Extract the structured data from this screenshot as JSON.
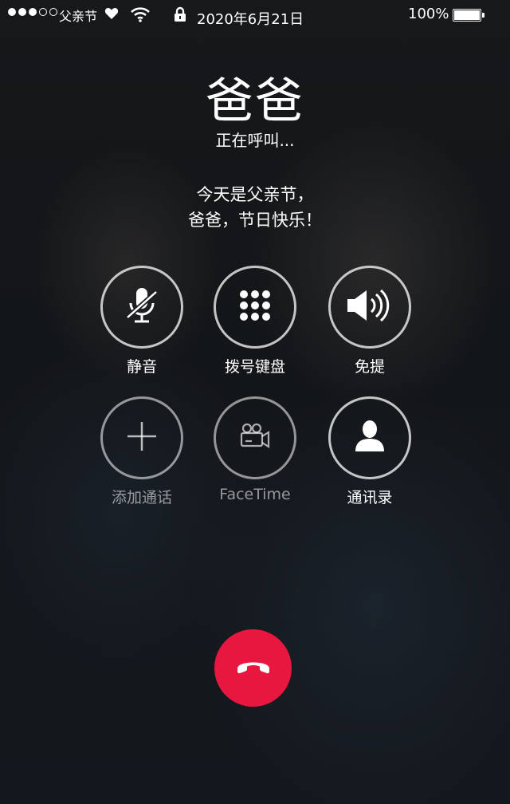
{
  "status_bar": {
    "carrier": "父亲节",
    "date": "2020年6月21日",
    "battery": "100%",
    "signal_icon": "signal-dots-icon",
    "heart_icon": "heart-icon",
    "wifi_icon": "wifi-icon",
    "lock_icon": "lock-icon",
    "battery_icon": "battery-icon"
  },
  "caller": {
    "name": "爸爸",
    "status": "正在呼叫..."
  },
  "message": {
    "line1": "今天是父亲节，",
    "line2": "爸爸，节日快乐！"
  },
  "controls": [
    {
      "label": "静音",
      "icon": "microphone-muted-icon",
      "enabled": true
    },
    {
      "label": "拨号键盘",
      "icon": "keypad-icon",
      "enabled": true
    },
    {
      "label": "免提",
      "icon": "speaker-icon",
      "enabled": true
    },
    {
      "label": "添加通话",
      "icon": "plus-icon",
      "enabled": false
    },
    {
      "label": "FaceTime",
      "icon": "video-camera-icon",
      "enabled": false
    },
    {
      "label": "通讯录",
      "icon": "contacts-icon",
      "enabled": true
    }
  ],
  "end_call": {
    "icon": "hang-up-phone-icon",
    "color": "#e8173f"
  }
}
